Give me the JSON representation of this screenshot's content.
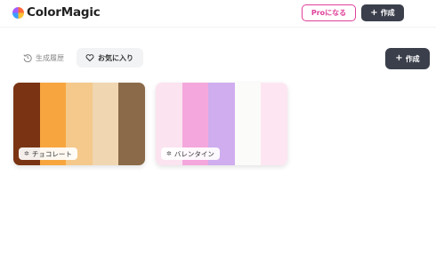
{
  "brand": {
    "name": "ColorMagic"
  },
  "header": {
    "pro_label": "Proになる",
    "create_label": "作成"
  },
  "tabs": [
    {
      "label": "生成履歴",
      "active": false
    },
    {
      "label": "お気に入り",
      "active": true
    }
  ],
  "main": {
    "create_label": "作成"
  },
  "palettes": [
    {
      "name": "チョコレート",
      "colors": [
        "#7a3413",
        "#f7a63f",
        "#f4c98b",
        "#f0d6b1",
        "#8a6a48"
      ]
    },
    {
      "name": "バレンタイン",
      "colors": [
        "#fbe3f0",
        "#f4a7dc",
        "#cfadef",
        "#fbfbf9",
        "#fde6f2"
      ]
    }
  ],
  "icons": {
    "history": "history-icon",
    "heart": "heart-icon",
    "plus": "plus-icon",
    "sparkle": "sparkle-icon"
  },
  "colors": {
    "accent": "#e0409a",
    "dark_button": "#3a3f4b"
  }
}
